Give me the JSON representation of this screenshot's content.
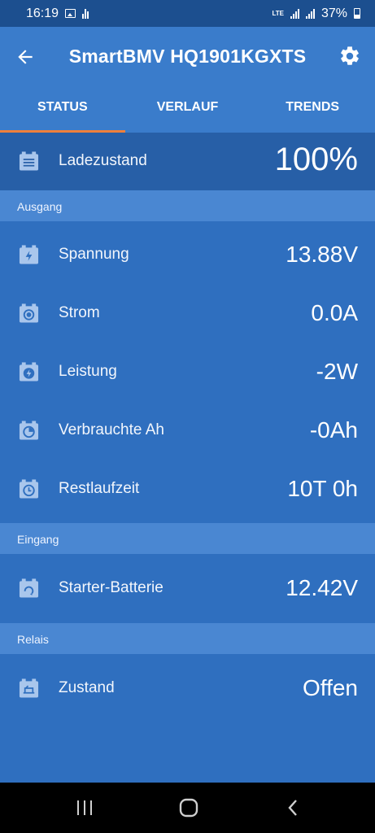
{
  "status_bar": {
    "time": "16:19",
    "network": "LTE",
    "battery": "37%"
  },
  "header": {
    "title": "SmartBMV HQ1901KGXTS",
    "back_icon": "arrow-left-icon",
    "settings_icon": "gear-icon"
  },
  "tabs": [
    {
      "label": "STATUS",
      "active": true
    },
    {
      "label": "VERLAUF",
      "active": false
    },
    {
      "label": "TRENDS",
      "active": false
    }
  ],
  "hero": {
    "label": "Ladezustand",
    "value": "100%",
    "icon": "battery-menu-icon"
  },
  "sections": {
    "ausgang": "Ausgang",
    "eingang": "Eingang",
    "relais": "Relais"
  },
  "ausgang_rows": [
    {
      "label": "Spannung",
      "value": "13.88V",
      "icon": "battery-bolt-icon"
    },
    {
      "label": "Strom",
      "value": "0.0A",
      "icon": "battery-dot-icon"
    },
    {
      "label": "Leistung",
      "value": "-2W",
      "icon": "battery-lightning-icon"
    },
    {
      "label": "Verbrauchte Ah",
      "value": "-0Ah",
      "icon": "battery-gauge-icon"
    },
    {
      "label": "Restlaufzeit",
      "value": "10T 0h",
      "icon": "battery-clock-icon"
    }
  ],
  "eingang_rows": [
    {
      "label": "Starter-Batterie",
      "value": "12.42V",
      "icon": "battery-refresh-icon"
    }
  ],
  "relais_rows": [
    {
      "label": "Zustand",
      "value": "Offen",
      "icon": "battery-relay-icon"
    }
  ],
  "colors": {
    "background": "#2f6fbf",
    "appbar": "#3a7ccb",
    "hero": "#275fa7",
    "section": "#4a87d2",
    "tab_indicator": "#ef7f3b"
  }
}
